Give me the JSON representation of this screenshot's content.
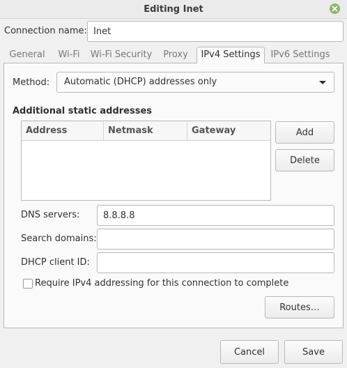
{
  "window": {
    "title": "Editing Inet",
    "close_icon": "close-icon"
  },
  "connection": {
    "name_label": "Connection name:",
    "name_value": "Inet"
  },
  "tabs": [
    {
      "label": "General",
      "active": false
    },
    {
      "label": "Wi-Fi",
      "active": false
    },
    {
      "label": "Wi-Fi Security",
      "active": false
    },
    {
      "label": "Proxy",
      "active": false
    },
    {
      "label": "IPv4 Settings",
      "active": true
    },
    {
      "label": "IPv6 Settings",
      "active": false
    }
  ],
  "ipv4": {
    "method_label": "Method:",
    "method_value": "Automatic (DHCP) addresses only",
    "static_heading": "Additional static addresses",
    "columns": [
      "Address",
      "Netmask",
      "Gateway"
    ],
    "rows": [],
    "add_label": "Add",
    "delete_label": "Delete",
    "dns_label": "DNS servers:",
    "dns_value": "8.8.8.8",
    "search_label": "Search domains:",
    "search_value": "",
    "dhcp_label": "DHCP client ID:",
    "dhcp_value": "",
    "require_label": "Require IPv4 addressing for this connection to complete",
    "require_checked": false,
    "routes_label": "Routes…"
  },
  "footer": {
    "cancel_label": "Cancel",
    "save_label": "Save"
  },
  "colors": {
    "close_button": "#8fb46a",
    "window_bg": "#f0f0f0"
  }
}
